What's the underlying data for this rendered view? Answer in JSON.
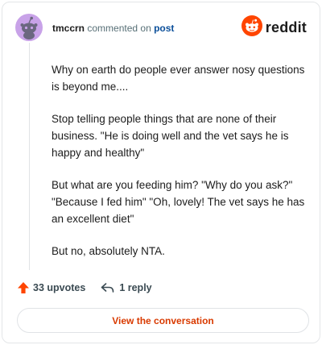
{
  "header": {
    "username": "tmccrn",
    "action_text": "commented on",
    "post_link": "post",
    "brand": "reddit"
  },
  "comment": {
    "paragraphs": [
      "Why on earth do people ever answer nosy questions is beyond me....",
      "Stop telling people things that are none of their business. \"He is doing well and the vet says he is happy and healthy\"",
      "But what are you feeding him? \"Why do you ask?\" \"Because I fed him\" \"Oh, lovely! The vet says he has an excellent diet\"",
      "But no, absolutely NTA."
    ]
  },
  "actions": {
    "upvotes": "33 upvotes",
    "replies": "1 reply"
  },
  "cta": {
    "label": "View the conversation"
  },
  "icons": {
    "avatar": "snoo-avatar-icon",
    "brand": "reddit-logo-icon",
    "upvote": "upvote-arrow-icon",
    "reply": "reply-arrow-icon"
  },
  "colors": {
    "accent": "#ff4500",
    "avatar_bg": "#c8a2e8",
    "post_link": "#0b4f9a",
    "cta_text": "#d93a00"
  }
}
